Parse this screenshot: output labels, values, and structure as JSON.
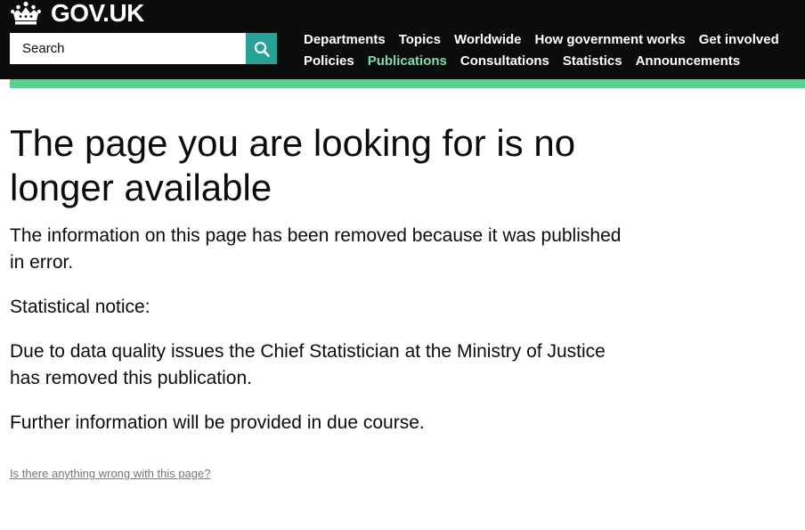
{
  "header": {
    "logo_text": "GOV.UK",
    "crown_icon": "crown-icon",
    "search": {
      "placeholder": "Search",
      "value": "",
      "button_icon": "search-icon"
    },
    "nav": {
      "row1": [
        "Departments",
        "Topics",
        "Worldwide",
        "How government works",
        "Get involved"
      ],
      "row2": [
        "Policies",
        "Publications",
        "Consultations",
        "Statistics",
        "Announcements"
      ],
      "active": "Publications"
    }
  },
  "colors": {
    "header_bg": "#0b0c0c",
    "accent_bar": "#5ad28f",
    "active_nav": "#85dba7",
    "search_button": "#28a197",
    "feedback_link": "#6f777b"
  },
  "main": {
    "title": "The page you are looking for is no longer available",
    "paragraphs": [
      "The information on this page has been removed because it was published in error.",
      "Statistical notice:",
      "Due to data quality issues the Chief Statistician at the Ministry of Justice has removed this publication.",
      "Further information will be provided in due course."
    ],
    "feedback_link": "Is there anything wrong with this page?"
  }
}
